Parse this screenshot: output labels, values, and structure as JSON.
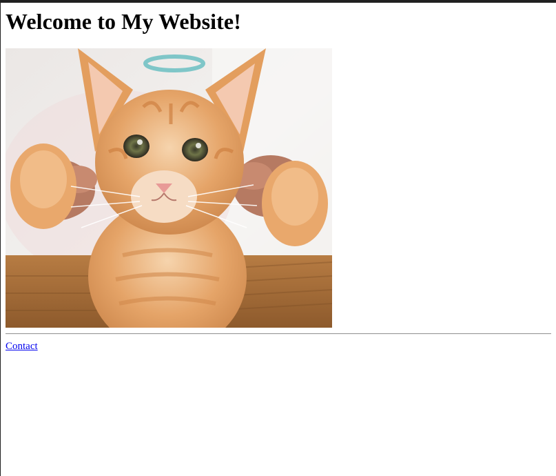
{
  "header": {
    "title": "Welcome to My Website!"
  },
  "main": {
    "image": {
      "subject": "kitten",
      "palette": {
        "fur": "#e2a068",
        "fur_light": "#f4d2ad",
        "background": "#e8e3df",
        "basket": "#a86f3a"
      }
    }
  },
  "footer": {
    "contact_link": "Contact",
    "link_color": "#0000ee"
  }
}
